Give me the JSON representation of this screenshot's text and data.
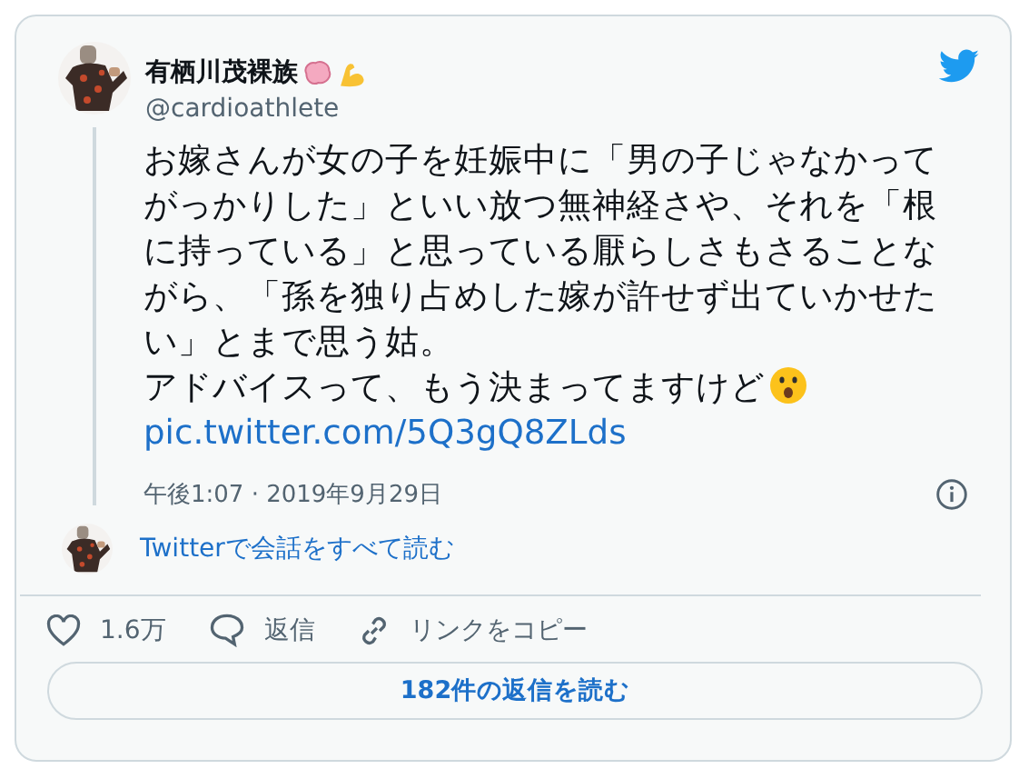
{
  "author": {
    "name": "有栖川茂裸族",
    "handle": "@cardioathlete"
  },
  "tweet": {
    "paragraphs": [
      "お嫁さんが女の子を妊娠中に「男の子じゃなかってがっかりした」といい放つ無神経さや、それを「根に持っている」と思っている厭らしさもさることながら、「孫を独り占めした嫁が許せず出ていかせたい」とまで思う姑。",
      "アドバイスって、もう決まってますけど"
    ],
    "link": "pic.twitter.com/5Q3gQ8ZLds",
    "timestamp": "午後1:07 · 2019年9月29日"
  },
  "thread_link": "Twitterで会話をすべて読む",
  "actions": [
    {
      "kind": "like",
      "label": "1.6万"
    },
    {
      "kind": "reply",
      "label": "返信"
    },
    {
      "kind": "copy",
      "label": "リンクをコピー"
    }
  ],
  "read_replies": "182件の返信を読む"
}
